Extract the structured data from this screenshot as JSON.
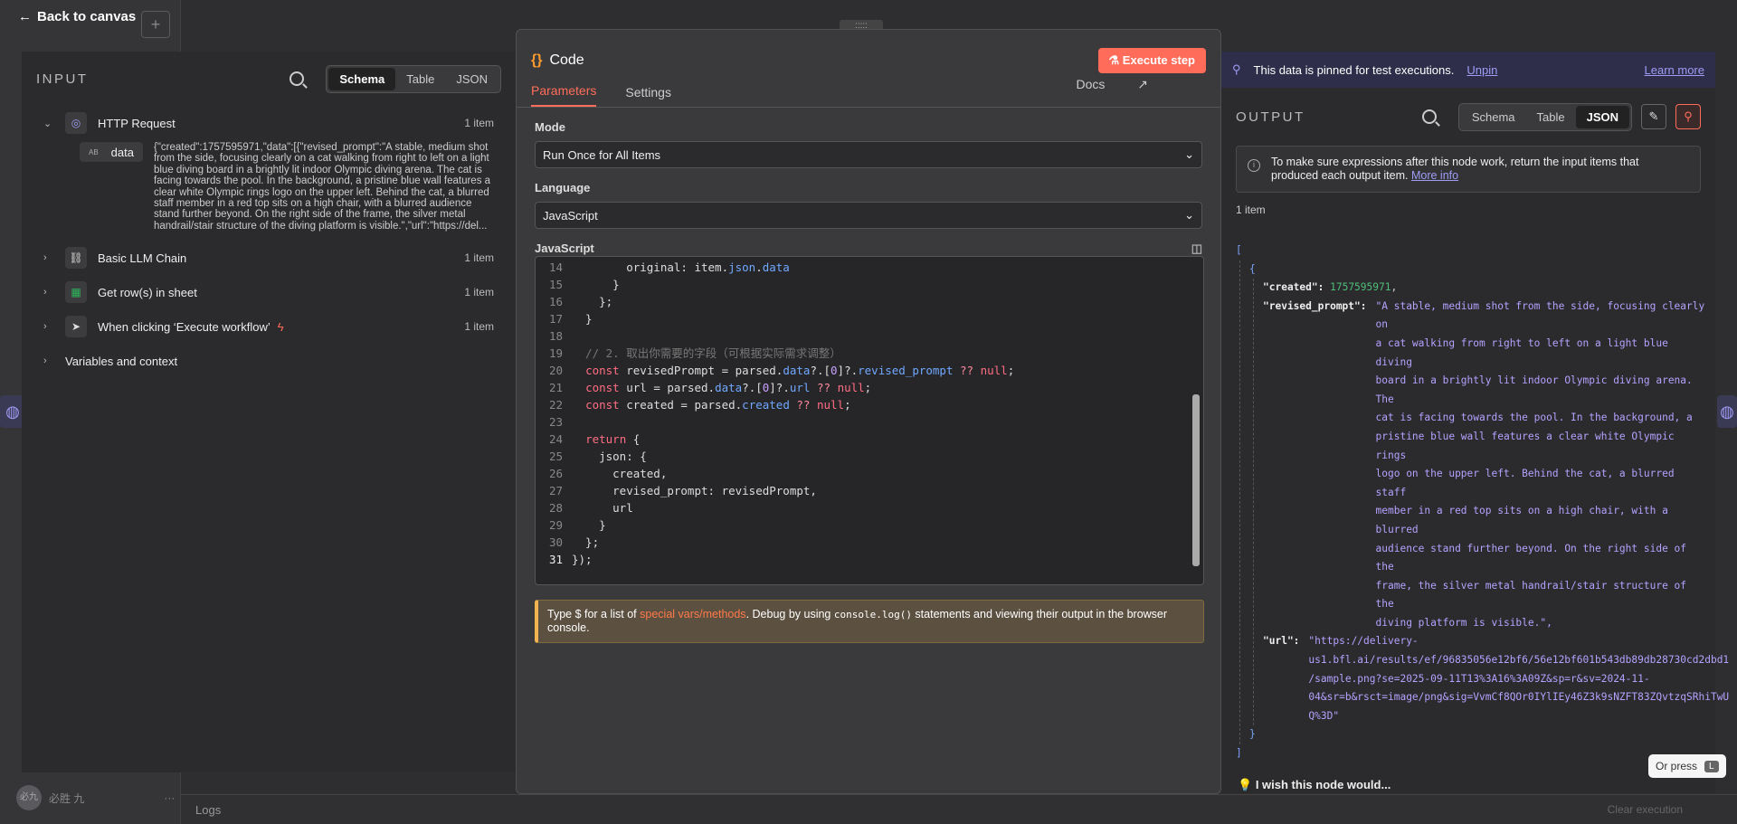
{
  "nav": {
    "back_label": "Back to canvas",
    "add_label": "+"
  },
  "user": {
    "initials": "必九",
    "name": "必胜 九",
    "more": "···"
  },
  "logs": {
    "label": "Logs",
    "clear_label": "Clear execution"
  },
  "input": {
    "title": "INPUT",
    "view_tabs": [
      "Schema",
      "Table",
      "JSON"
    ],
    "active_tab": "Schema",
    "nodes": [
      {
        "label": "HTTP Request",
        "count": "1 item",
        "expanded": true,
        "icon": "globe-icon"
      },
      {
        "label": "Basic LLM Chain",
        "count": "1 item",
        "expanded": false,
        "icon": "link-icon"
      },
      {
        "label": "Get row(s) in sheet",
        "count": "1 item",
        "expanded": false,
        "icon": "sheet-icon"
      },
      {
        "label": "When clicking ‘Execute workflow’",
        "count": "1 item",
        "expanded": false,
        "icon": "pointer-icon"
      }
    ],
    "data_key": "data",
    "data_type": "AB",
    "data_value": "{\"created\":1757595971,\"data\":[{\"revised_prompt\":\"A stable, medium shot from the side, focusing clearly on a cat walking from right to left on a light blue diving board in a brightly lit indoor Olympic diving arena. The cat is facing towards the pool. In the background, a pristine blue wall features a clear white Olympic rings logo on the upper left. Behind the cat, a blurred staff member in a red top sits on a high chair, with a blurred audience stand further beyond. On the right side of the frame, the silver metal handrail/stair structure of the diving platform is visible.\",\"url\":\"https://del...",
    "variables_label": "Variables and context"
  },
  "code": {
    "title": "Code",
    "execute_label": "Execute step",
    "tabs": [
      "Parameters",
      "Settings"
    ],
    "active_tab": "Parameters",
    "docs_label": "Docs",
    "mode_label": "Mode",
    "mode_value": "Run Once for All Items",
    "language_label": "Language",
    "language_value": "JavaScript",
    "editor_label": "JavaScript",
    "lines": [
      {
        "n": "14",
        "text": "        original: item.json.data"
      },
      {
        "n": "15",
        "text": "      }"
      },
      {
        "n": "16",
        "text": "    };"
      },
      {
        "n": "17",
        "text": "  }"
      },
      {
        "n": "18",
        "text": ""
      },
      {
        "n": "19",
        "text": "  // 2. 取出你需要的字段（可根据实际需求调整）"
      },
      {
        "n": "20",
        "text": "  const revisedPrompt = parsed.data?.[0]?.revised_prompt ?? null;"
      },
      {
        "n": "21",
        "text": "  const url = parsed.data?.[0]?.url ?? null;"
      },
      {
        "n": "22",
        "text": "  const created = parsed.created ?? null;"
      },
      {
        "n": "23",
        "text": ""
      },
      {
        "n": "24",
        "text": "  return {"
      },
      {
        "n": "25",
        "text": "    json: {"
      },
      {
        "n": "26",
        "text": "      created,"
      },
      {
        "n": "27",
        "text": "      revised_prompt: revisedPrompt,"
      },
      {
        "n": "28",
        "text": "      url"
      },
      {
        "n": "29",
        "text": "    }"
      },
      {
        "n": "30",
        "text": "  };"
      },
      {
        "n": "31",
        "text": "});"
      }
    ],
    "hint_prefix": "Type $ for a list of ",
    "hint_link": "special vars/methods",
    "hint_mid": ". Debug by using ",
    "hint_code": "console.log()",
    "hint_suffix": " statements and viewing their output in the browser console."
  },
  "output": {
    "pin_text": "This data is pinned for test executions.",
    "unpin_label": "Unpin",
    "learn_more_label": "Learn more",
    "title": "OUTPUT",
    "view_tabs": [
      "Schema",
      "Table",
      "JSON"
    ],
    "active_tab": "JSON",
    "callout_text": "To make sure expressions after this node work, return the input items that produced each output item.",
    "callout_link": "More info",
    "count": "1 item",
    "json": {
      "created_key": "\"created\":",
      "created_val": "1757595971",
      "prompt_key": "\"revised_prompt\":",
      "prompt_lines": [
        "\"A stable, medium shot from the side, focusing clearly on",
        "a cat walking from right to left on a light blue diving",
        "board in a brightly lit indoor Olympic diving arena. The",
        "cat is facing towards the pool. In the background, a",
        "pristine blue wall features a clear white Olympic rings",
        "logo on the upper left. Behind the cat, a blurred staff",
        "member in a red top sits on a high chair, with a blurred",
        "audience stand further beyond. On the right side of the",
        "frame, the silver metal handrail/stair structure of the",
        "diving platform is visible.\","
      ],
      "url_key": "\"url\":",
      "url_lines": [
        "\"https://delivery-",
        "us1.bfl.ai/results/ef/96835056e12bf6/56e12bf601b543db89db28730cd2dbd1",
        "/sample.png?se=2025-09-11T13%3A16%3A09Z&sp=r&sv=2024-11-",
        "04&sr=b&rsct=image/png&sig=VvmCf8QOr0IYlIEy46Z3k9sNZFT83ZQvtzqSRhiTwU",
        "Q%3D\""
      ]
    }
  },
  "footer": {
    "wish_label": "I wish this node would...",
    "or_press_label": "Or press",
    "or_press_key": "L"
  }
}
